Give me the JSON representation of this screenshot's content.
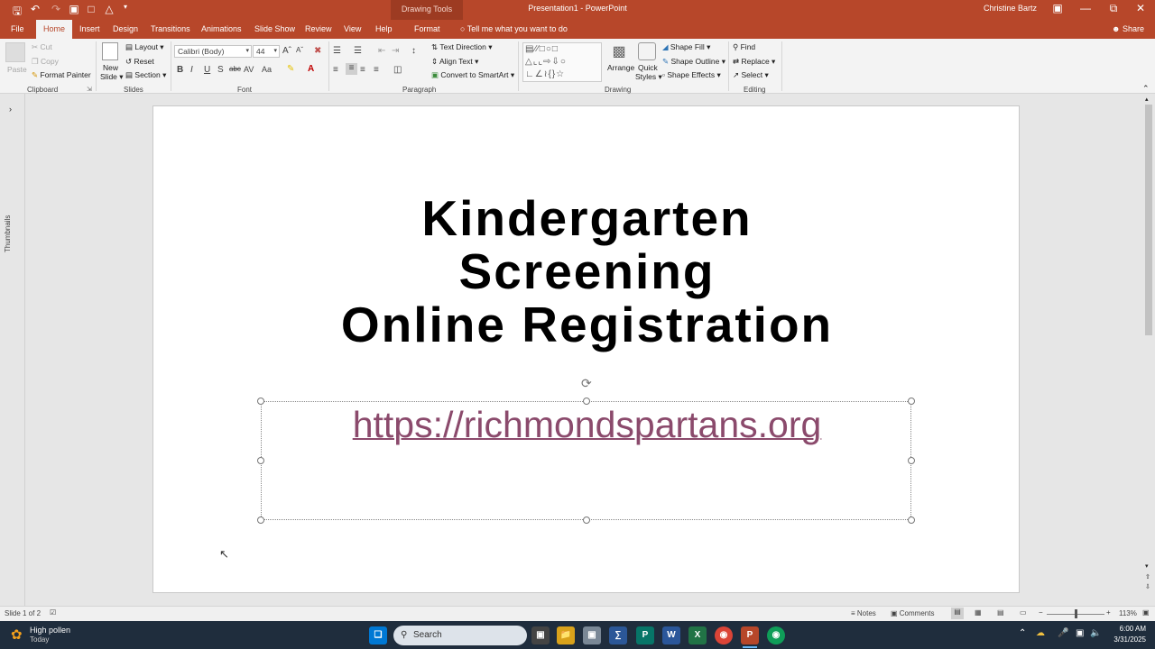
{
  "titlebar": {
    "context_tools": "Drawing Tools",
    "doc_title": "Presentation1  -  PowerPoint",
    "user": "Christine Bartz",
    "colors": {
      "accent": "#b7472a"
    }
  },
  "tabs": [
    "File",
    "Home",
    "Insert",
    "Design",
    "Transitions",
    "Animations",
    "Slide Show",
    "Review",
    "View",
    "Help",
    "Format"
  ],
  "tell_me": "Tell me what you want to do",
  "share": "Share",
  "ribbon": {
    "clipboard": {
      "paste": "Paste",
      "cut": "Cut",
      "copy": "Copy",
      "format_painter": "Format Painter",
      "group": "Clipboard"
    },
    "slides": {
      "new_slide": "New",
      "new_slide2": "Slide",
      "layout": "Layout",
      "reset": "Reset",
      "section": "Section",
      "group": "Slides"
    },
    "font": {
      "name": "Calibri (Body)",
      "size": "44",
      "group": "Font"
    },
    "paragraph": {
      "text_direction": "Text Direction",
      "align_text": "Align Text",
      "smartart": "Convert to SmartArt",
      "group": "Paragraph"
    },
    "drawing": {
      "arrange": "Arrange",
      "quick_styles": "Quick",
      "quick_styles2": "Styles",
      "shape_fill": "Shape Fill",
      "shape_outline": "Shape Outline",
      "shape_effects": "Shape Effects",
      "group": "Drawing"
    },
    "editing": {
      "find": "Find",
      "replace": "Replace",
      "select": "Select",
      "group": "Editing"
    }
  },
  "left_panel": {
    "label": "Thumbnails"
  },
  "slide": {
    "title_lines": [
      "Kindergarten",
      "Screening",
      "Online Registration"
    ],
    "subtitle_link": "https://richmondspartans.org"
  },
  "status": {
    "slide_counter": "Slide 1 of 2",
    "notes": "Notes",
    "comments": "Comments",
    "zoom": "113%"
  },
  "taskbar": {
    "weather_title": "High pollen",
    "weather_sub": "Today",
    "search": "Search",
    "time": "6:00 AM",
    "date": "3/31/2025"
  }
}
